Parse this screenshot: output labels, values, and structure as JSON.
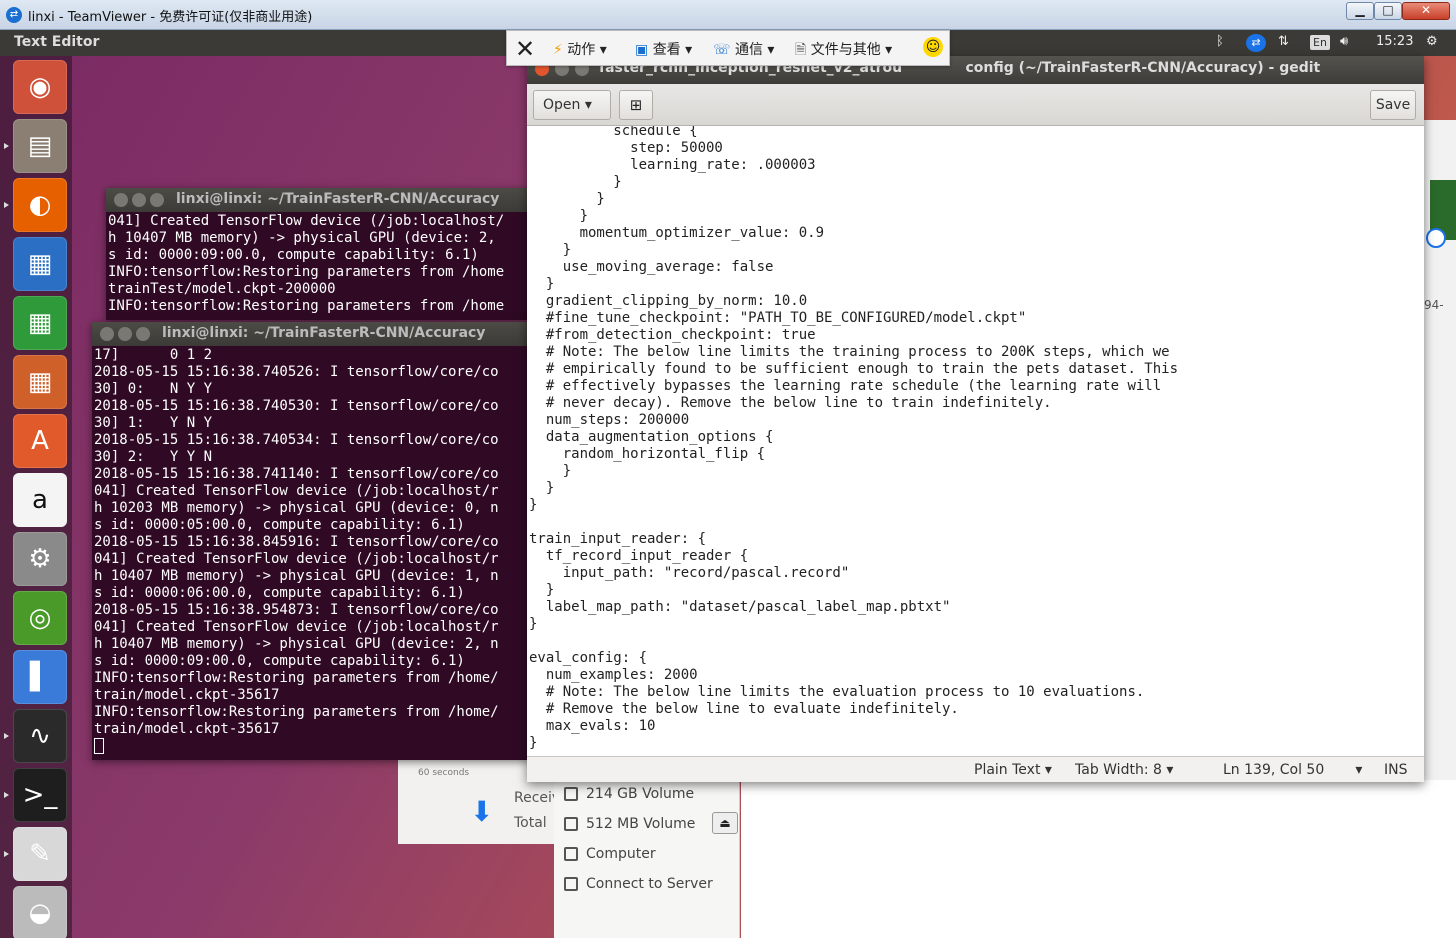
{
  "tv": {
    "title": "linxi - TeamViewer - 免费许可证(仅非商业用途)",
    "min": "▁",
    "max": "□",
    "close": "✕",
    "toolbar": {
      "close": "✕",
      "action": "动作",
      "view": "查看",
      "comm": "通信",
      "files": "文件与其他",
      "smile": "☺"
    }
  },
  "panel": {
    "title": "Text Editor",
    "lang": "En",
    "clock": "15:23"
  },
  "launcher": [
    {
      "name": "ubuntu-dash",
      "glyph": "◉",
      "color": "#d0513a"
    },
    {
      "name": "files",
      "glyph": "▤",
      "color": "#8a7f72"
    },
    {
      "name": "firefox",
      "glyph": "◐",
      "color": "#e66000"
    },
    {
      "name": "writer",
      "glyph": "▦",
      "color": "#2a6fc4"
    },
    {
      "name": "calc",
      "glyph": "▦",
      "color": "#2f9a3a"
    },
    {
      "name": "impress",
      "glyph": "▦",
      "color": "#d0602a"
    },
    {
      "name": "software",
      "glyph": "A",
      "color": "#e05a2b"
    },
    {
      "name": "amazon",
      "glyph": "a",
      "color": "#f4f4f4"
    },
    {
      "name": "settings",
      "glyph": "⚙",
      "color": "#8a8a8a"
    },
    {
      "name": "nvidia",
      "glyph": "◎",
      "color": "#4a9a2a"
    },
    {
      "name": "thermometer",
      "glyph": "▌",
      "color": "#3a7ad8"
    },
    {
      "name": "system-monitor",
      "glyph": "∿",
      "color": "#2a2a2a"
    },
    {
      "name": "terminal",
      "glyph": ">_",
      "color": "#1e1e1e"
    },
    {
      "name": "text-editor",
      "glyph": "✎",
      "color": "#d8d8d8"
    },
    {
      "name": "disk",
      "glyph": "◒",
      "color": "#bbbbbb"
    }
  ],
  "term1": {
    "title": "linxi@linxi: ~/TrainFasterR-CNN/Accuracy",
    "lines": [
      "041] Created TensorFlow device (/job:localhost/",
      "h 10407 MB memory) -> physical GPU (device: 2,",
      "s id: 0000:09:00.0, compute capability: 6.1)",
      "INFO:tensorflow:Restoring parameters from /home",
      "trainTest/model.ckpt-200000",
      "INFO:tensorflow:Restoring parameters from /home"
    ]
  },
  "term2": {
    "title": "linxi@linxi: ~/TrainFasterR-CNN/Accuracy",
    "lines": [
      "17]      0 1 2",
      "2018-05-15 15:16:38.740526: I tensorflow/core/co",
      "30] 0:   N Y Y",
      "2018-05-15 15:16:38.740530: I tensorflow/core/co",
      "30] 1:   Y N Y",
      "2018-05-15 15:16:38.740534: I tensorflow/core/co",
      "30] 2:   Y Y N",
      "2018-05-15 15:16:38.741140: I tensorflow/core/co",
      "041] Created TensorFlow device (/job:localhost/r",
      "h 10203 MB memory) -> physical GPU (device: 0, n",
      "s id: 0000:05:00.0, compute capability: 6.1)",
      "2018-05-15 15:16:38.845916: I tensorflow/core/co",
      "041] Created TensorFlow device (/job:localhost/r",
      "h 10407 MB memory) -> physical GPU (device: 1, n",
      "s id: 0000:06:00.0, compute capability: 6.1)",
      "2018-05-15 15:16:38.954873: I tensorflow/core/co",
      "041] Created TensorFlow device (/job:localhost/r",
      "h 10407 MB memory) -> physical GPU (device: 2, n",
      "s id: 0000:09:00.0, compute capability: 6.1)",
      "INFO:tensorflow:Restoring parameters from /home/",
      "train/model.ckpt-35617",
      "INFO:tensorflow:Restoring parameters from /home/",
      "train/model.ckpt-35617"
    ]
  },
  "nautilus": {
    "graph_label": "60 seconds",
    "receiving": "Receiv",
    "total": "Total",
    "items": [
      "214 GB Volume",
      "512 MB Volume",
      "Computer",
      "Connect to Server"
    ],
    "eject": "⏏"
  },
  "right": {
    "label": "94-"
  },
  "gedit": {
    "title": "faster_rcnn_inception_resnet_v2_atrou             config (~/TrainFasterR-CNN/Accuracy) - gedit",
    "open_label": "Open",
    "newtab_label": "⊞",
    "save_label": "Save",
    "lines": [
      "          schedule {",
      "            step: 50000",
      "            learning_rate: .000003",
      "          }",
      "        }",
      "      }",
      "      momentum_optimizer_value: 0.9",
      "    }",
      "    use_moving_average: false",
      "  }",
      "  gradient_clipping_by_norm: 10.0",
      "  #fine_tune_checkpoint: \"PATH_TO_BE_CONFIGURED/model.ckpt\"",
      "  #from_detection_checkpoint: true",
      "  # Note: The below line limits the training process to 200K steps, which we",
      "  # empirically found to be sufficient enough to train the pets dataset. This",
      "  # effectively bypasses the learning rate schedule (the learning rate will",
      "  # never decay). Remove the below line to train indefinitely.",
      "  num_steps: 200000",
      "  data_augmentation_options {",
      "    random_horizontal_flip {",
      "    }",
      "  }",
      "}",
      "",
      "train_input_reader: {",
      "  tf_record_input_reader {",
      "    input_path: \"record/pascal.record\"",
      "  }",
      "  label_map_path: \"dataset/pascal_label_map.pbtxt\"",
      "}",
      "",
      "eval_config: {",
      "  num_examples: 2000",
      "  # Note: The below line limits the evaluation process to 10 evaluations.",
      "  # Remove the below line to evaluate indefinitely.",
      "  max_evals: 10",
      "}"
    ],
    "status": {
      "language": "Plain Text ▾",
      "tab_width": "Tab Width: 8 ▾",
      "position": "Ln 139, Col 50",
      "position_caret": "▾",
      "mode": "INS"
    }
  }
}
